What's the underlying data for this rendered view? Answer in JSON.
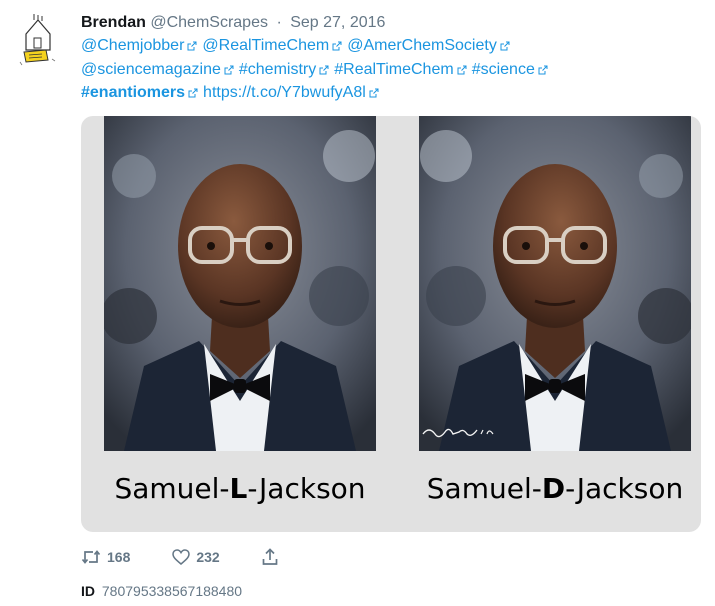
{
  "tweet": {
    "author_name": "Brendan",
    "author_handle": "@ChemScrapes",
    "separator": "·",
    "date": "Sep 27, 2016",
    "text_lines": [
      [
        {
          "text": "@Chemjobber",
          "bold": false
        },
        {
          "text": "@RealTimeChem",
          "bold": false
        },
        {
          "text": "@AmerChemSociety",
          "bold": false
        }
      ],
      [
        {
          "text": "@sciencemagazine",
          "bold": false
        },
        {
          "text": "#chemistry",
          "bold": false
        },
        {
          "text": "#RealTimeChem",
          "bold": false
        },
        {
          "text": "#science",
          "bold": false
        }
      ],
      [
        {
          "text": "#enantiomers",
          "bold": true
        },
        {
          "text": "https://t.co/Y7bwufyA8l",
          "bold": false
        }
      ]
    ],
    "link_icon": "external-link-icon",
    "avatar_icon": "sketch-avatar-icon"
  },
  "media": {
    "left_caption": {
      "pre": "Samuel-",
      "bold": "L",
      "post": "-Jackson"
    },
    "right_caption": {
      "pre": "Samuel-",
      "bold": "D",
      "post": "-Jackson"
    },
    "signature_text": "Brendan '16"
  },
  "actions": {
    "retweet_count": "168",
    "like_count": "232",
    "retweet_icon": "retweet-icon",
    "like_icon": "heart-icon",
    "share_icon": "share-icon"
  },
  "footer": {
    "id_label": "ID",
    "id_value": "780795338567188480"
  },
  "colors": {
    "link": "#1b95e0",
    "muted": "#657786",
    "text": "#14171a",
    "card_bg": "#e1e1e1"
  }
}
